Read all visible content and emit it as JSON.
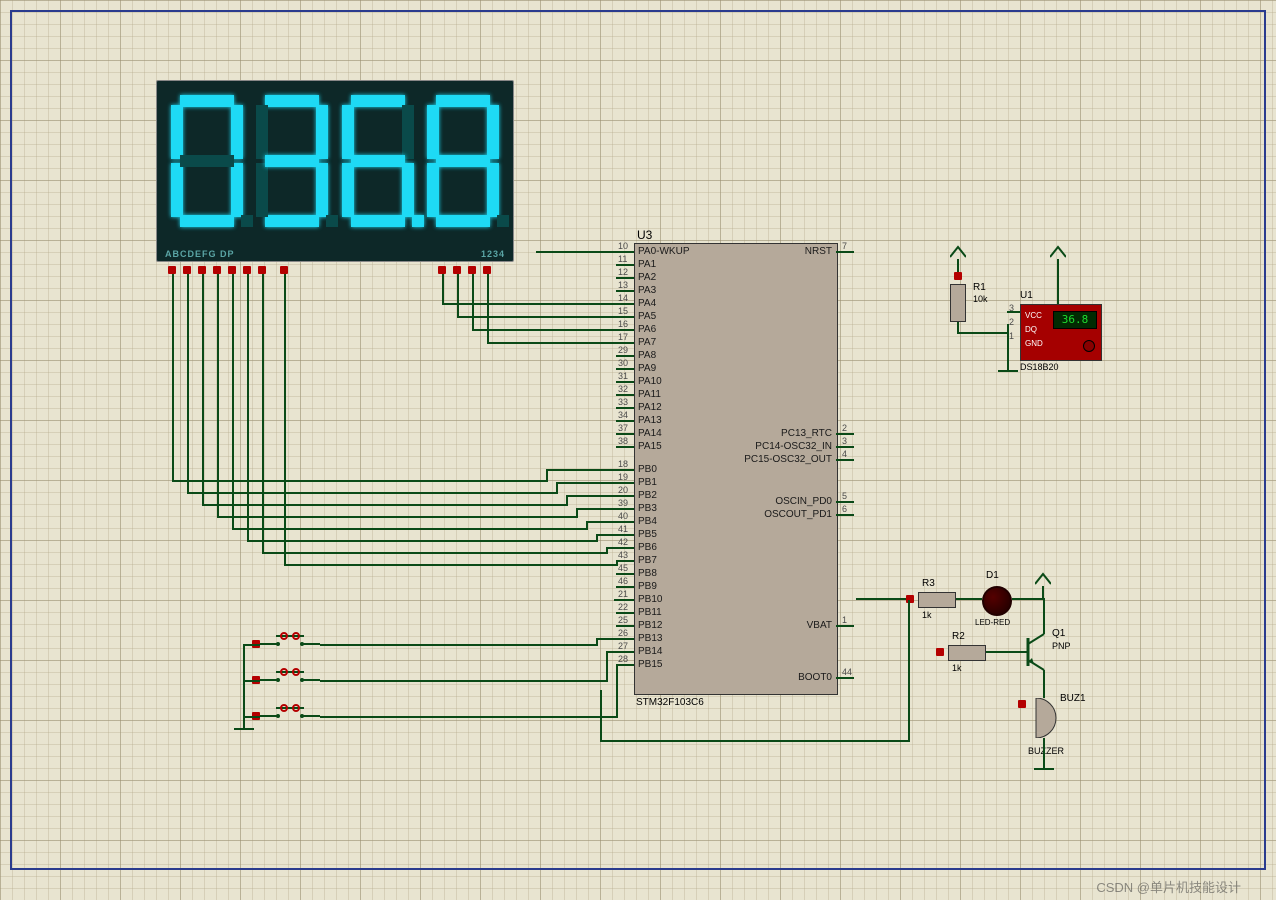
{
  "display": {
    "digits": [
      "0",
      "3",
      "6",
      "8"
    ],
    "decimal_after": 2,
    "seg_label_left": "ABCDEFG DP",
    "seg_label_right": "1234"
  },
  "chip": {
    "ref": "U3",
    "part": "STM32F103C6",
    "left_pins": [
      {
        "num": "10",
        "name": "PA0-WKUP"
      },
      {
        "num": "11",
        "name": "PA1"
      },
      {
        "num": "12",
        "name": "PA2"
      },
      {
        "num": "13",
        "name": "PA3"
      },
      {
        "num": "14",
        "name": "PA4"
      },
      {
        "num": "15",
        "name": "PA5"
      },
      {
        "num": "16",
        "name": "PA6"
      },
      {
        "num": "17",
        "name": "PA7"
      },
      {
        "num": "29",
        "name": "PA8"
      },
      {
        "num": "30",
        "name": "PA9"
      },
      {
        "num": "31",
        "name": "PA10"
      },
      {
        "num": "32",
        "name": "PA11"
      },
      {
        "num": "33",
        "name": "PA12"
      },
      {
        "num": "34",
        "name": "PA13"
      },
      {
        "num": "37",
        "name": "PA14"
      },
      {
        "num": "38",
        "name": "PA15"
      },
      {
        "num": "18",
        "name": "PB0"
      },
      {
        "num": "19",
        "name": "PB1"
      },
      {
        "num": "20",
        "name": "PB2"
      },
      {
        "num": "39",
        "name": "PB3"
      },
      {
        "num": "40",
        "name": "PB4"
      },
      {
        "num": "41",
        "name": "PB5"
      },
      {
        "num": "42",
        "name": "PB6"
      },
      {
        "num": "43",
        "name": "PB7"
      },
      {
        "num": "45",
        "name": "PB8"
      },
      {
        "num": "46",
        "name": "PB9"
      },
      {
        "num": "21",
        "name": "PB10"
      },
      {
        "num": "22",
        "name": "PB11"
      },
      {
        "num": "25",
        "name": "PB12"
      },
      {
        "num": "26",
        "name": "PB13"
      },
      {
        "num": "27",
        "name": "PB14"
      },
      {
        "num": "28",
        "name": "PB15"
      }
    ],
    "right_pins": [
      {
        "num": "7",
        "name": "NRST"
      },
      {
        "num": "2",
        "name": "PC13_RTC"
      },
      {
        "num": "3",
        "name": "PC14-OSC32_IN"
      },
      {
        "num": "4",
        "name": "PC15-OSC32_OUT"
      },
      {
        "num": "5",
        "name": "OSCIN_PD0"
      },
      {
        "num": "6",
        "name": "OSCOUT_PD1"
      },
      {
        "num": "1",
        "name": "VBAT"
      },
      {
        "num": "44",
        "name": "BOOT0"
      }
    ]
  },
  "components": {
    "r1": {
      "ref": "R1",
      "value": "10k"
    },
    "r2": {
      "ref": "R2",
      "value": "1k"
    },
    "r3": {
      "ref": "R3",
      "value": "1k"
    },
    "u1": {
      "ref": "U1",
      "part": "DS18B20",
      "pins": [
        "VCC",
        "DQ",
        "GND"
      ],
      "pinnums": [
        "3",
        "2",
        "1"
      ],
      "reading": "36.8"
    },
    "d1": {
      "ref": "D1",
      "part": "LED-RED"
    },
    "q1": {
      "ref": "Q1",
      "part": "PNP"
    },
    "buz1": {
      "ref": "BUZ1",
      "part": "BUZZER"
    }
  },
  "watermark": "CSDN @单片机技能设计"
}
